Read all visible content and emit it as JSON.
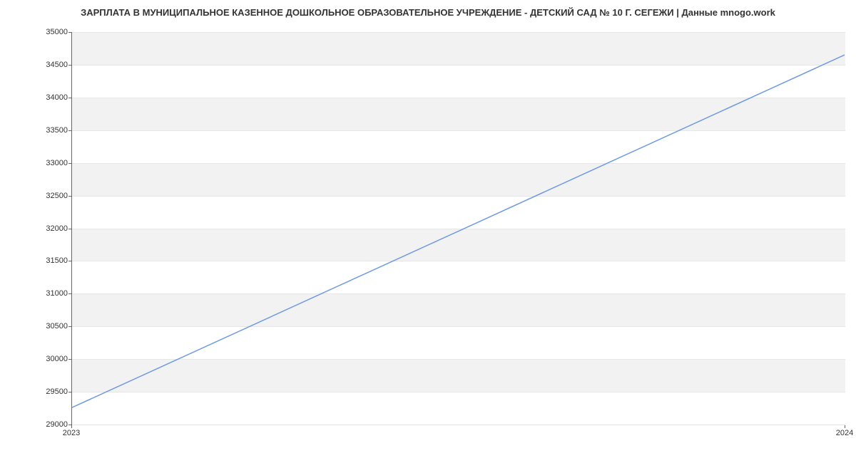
{
  "chart_data": {
    "type": "line",
    "title": "ЗАРПЛАТА В МУНИЦИПАЛЬНОЕ КАЗЕННОЕ ДОШКОЛЬНОЕ ОБРАЗОВАТЕЛЬНОЕ УЧРЕЖДЕНИЕ - ДЕТСКИЙ САД № 10 Г. СЕГЕЖИ | Данные mnogo.work",
    "xlabel": "",
    "ylabel": "",
    "x": [
      2023,
      2024
    ],
    "values": [
      29250,
      34650
    ],
    "xlim": [
      2023,
      2024
    ],
    "ylim": [
      29000,
      35000
    ],
    "x_ticks": [
      2023,
      2024
    ],
    "y_ticks": [
      29000,
      29500,
      30000,
      30500,
      31000,
      31500,
      32000,
      32500,
      33000,
      33500,
      34000,
      34500,
      35000
    ],
    "line_color": "#6f9ae3"
  }
}
